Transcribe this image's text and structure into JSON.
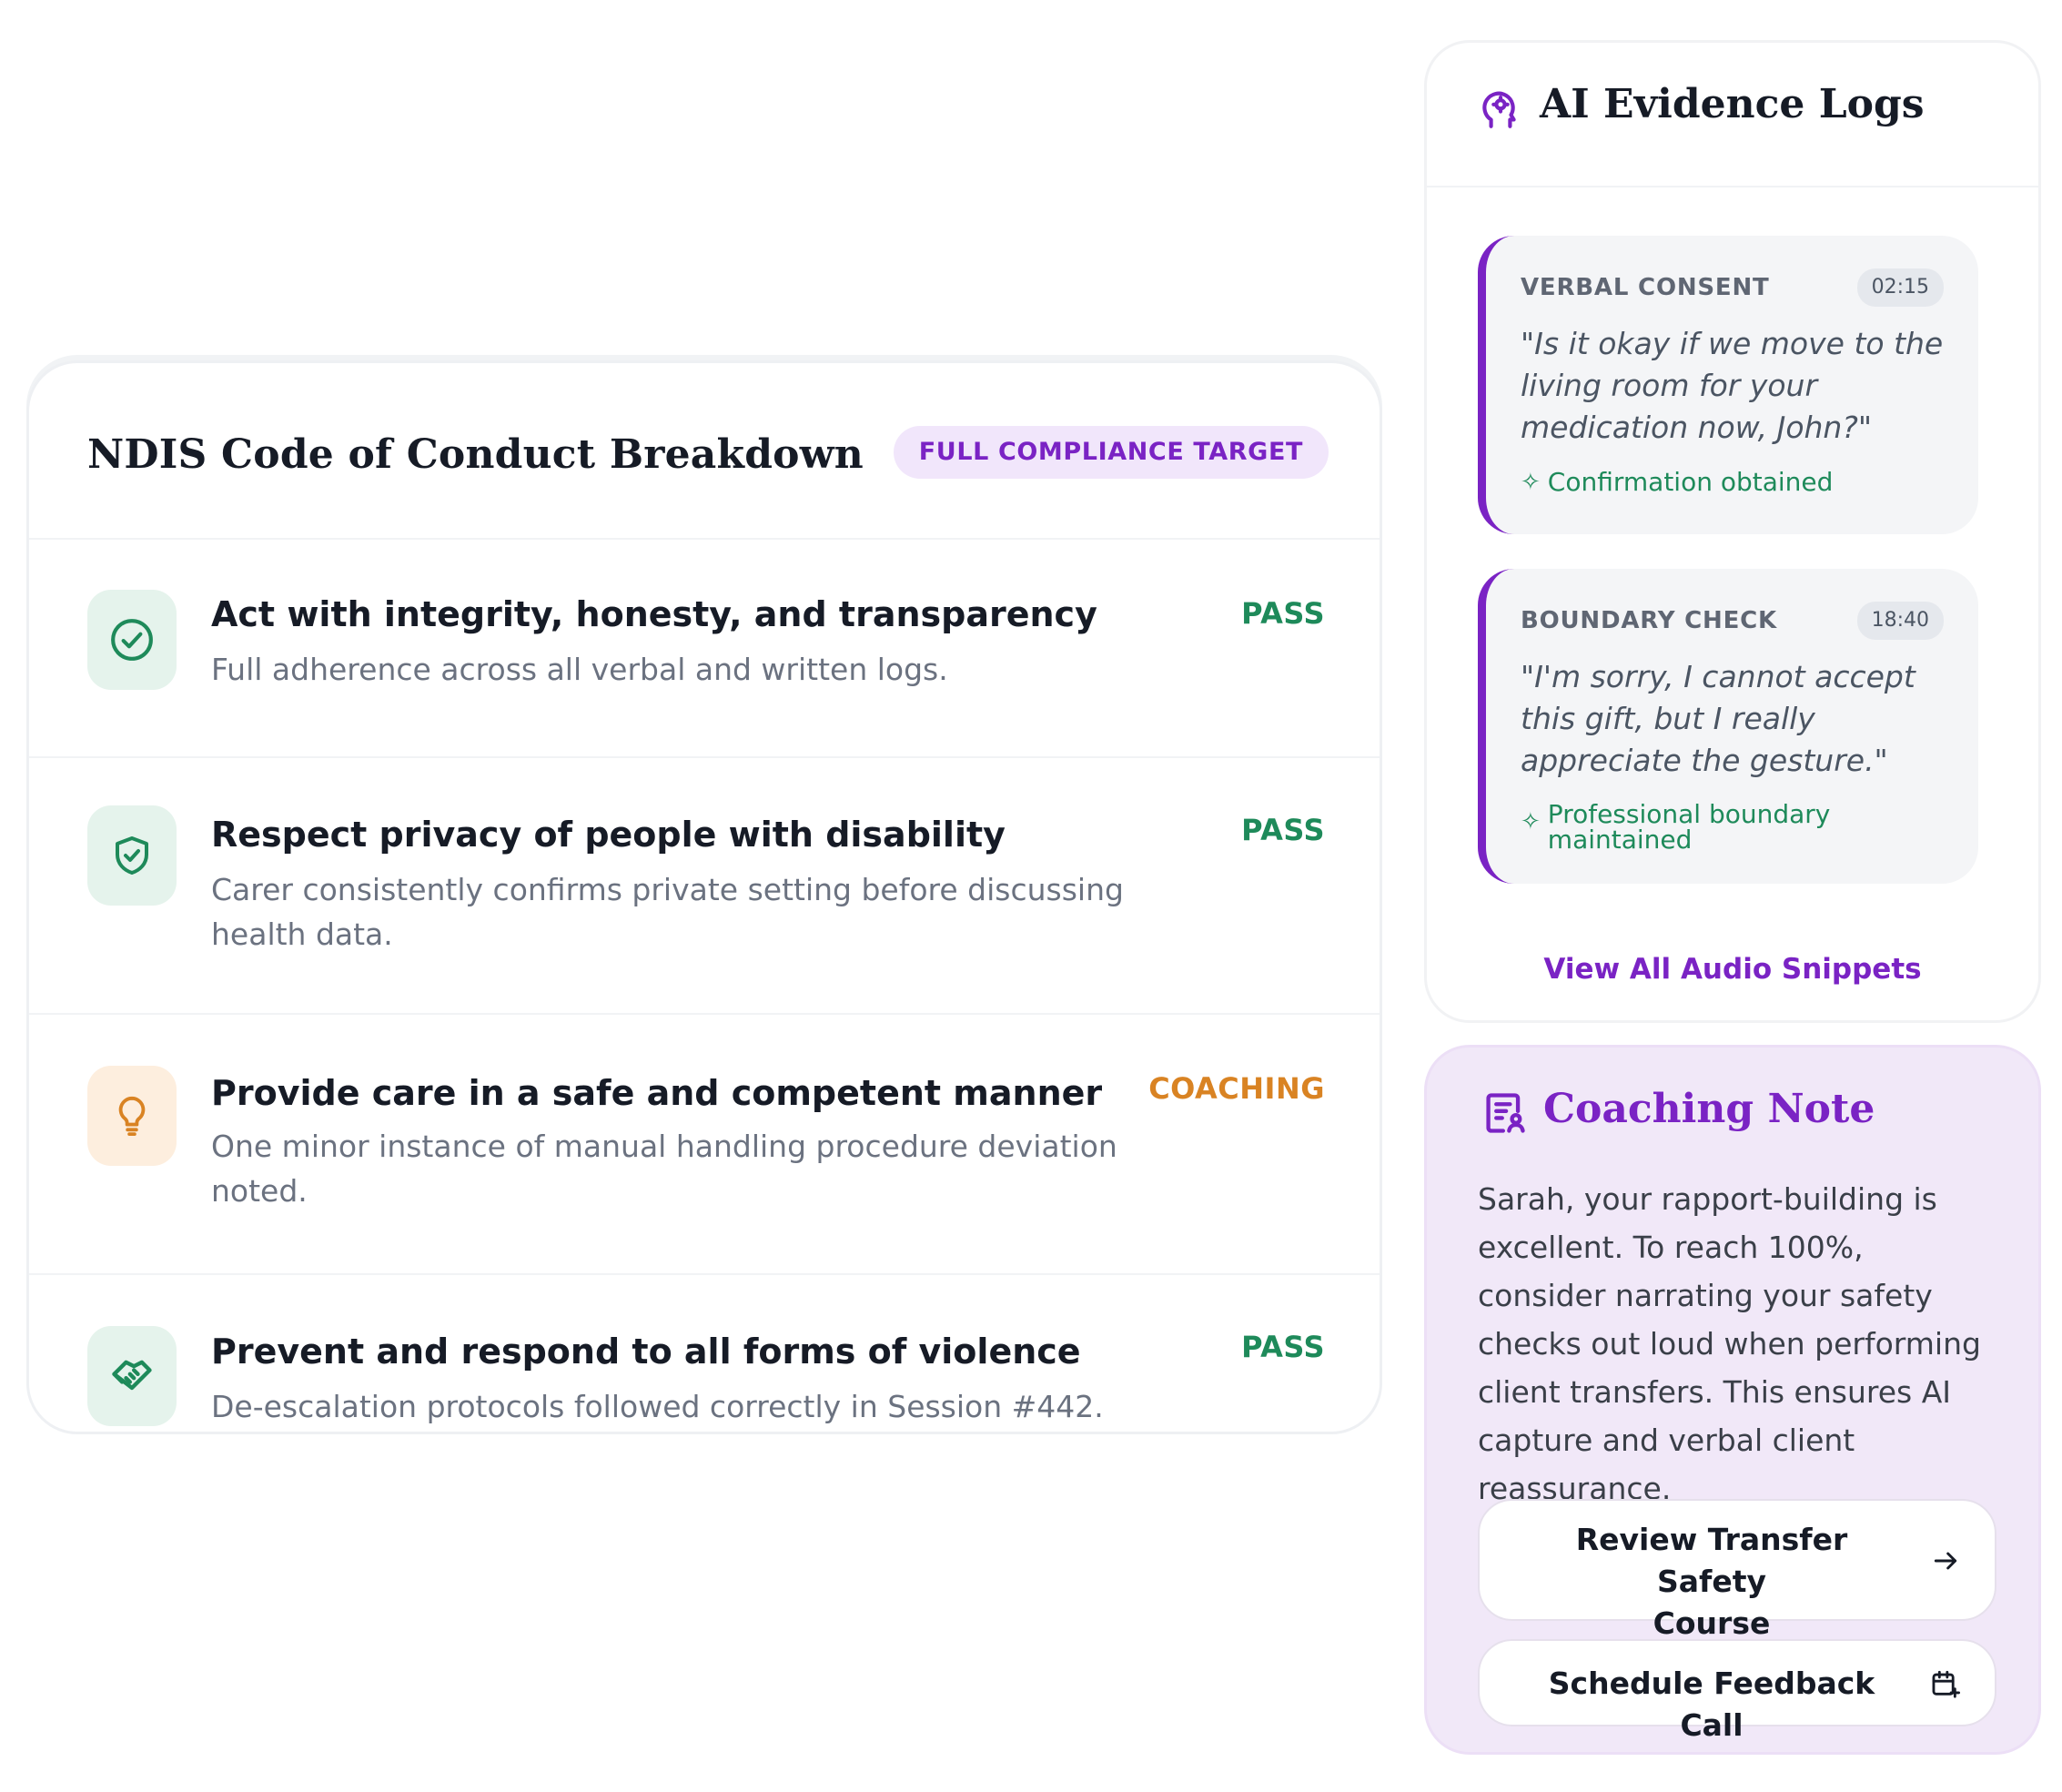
{
  "conduct": {
    "title": "NDIS Code of Conduct Breakdown",
    "badge": "FULL COMPLIANCE TARGET",
    "rules": [
      {
        "title": "Act with integrity, honesty, and transparency",
        "description": "Full adherence across all verbal and written logs.",
        "status": "PASS",
        "icon": "check-circle-icon"
      },
      {
        "title": "Respect privacy of people with disability",
        "description": "Carer consistently confirms private setting before discussing health data.",
        "status": "PASS",
        "icon": "shield-check-icon"
      },
      {
        "title": "Provide care in a safe and competent manner",
        "description": "One minor instance of manual handling procedure deviation noted.",
        "status": "COACHING",
        "icon": "lightbulb-icon"
      },
      {
        "title": "Prevent and respond to all forms of violence",
        "description": "De-escalation protocols followed correctly in Session #442.",
        "status": "PASS",
        "icon": "handshake-icon"
      }
    ]
  },
  "evidence": {
    "title": "AI Evidence Logs",
    "icon": "ai-head-icon",
    "logs": [
      {
        "label": "VERBAL CONSENT",
        "time": "02:15",
        "quote": "\"Is it okay if we move to the living room for your medication now, John?\"",
        "result": "Confirmation obtained"
      },
      {
        "label": "BOUNDARY CHECK",
        "time": "18:40",
        "quote": "\"I'm sorry, I cannot accept this gift, but I really appreciate the gesture.\"",
        "result_line1": "Professional boundary",
        "result_line2": "maintained"
      }
    ],
    "view_all": "View All Audio Snippets"
  },
  "coaching": {
    "title": "Coaching Note",
    "icon": "clipboard-person-icon",
    "text": "Sarah, your rapport-building is excellent. To reach 100%, consider narrating your safety checks out loud when performing client transfers. This ensures AI capture and verbal client reassurance.",
    "button1_line1": "Review Transfer Safety",
    "button1_line2": "Course",
    "button2": "Schedule Feedback Call"
  },
  "colors": {
    "accent": "#7a23c4",
    "pass": "#1e8a5a",
    "coaching": "#d98323"
  }
}
